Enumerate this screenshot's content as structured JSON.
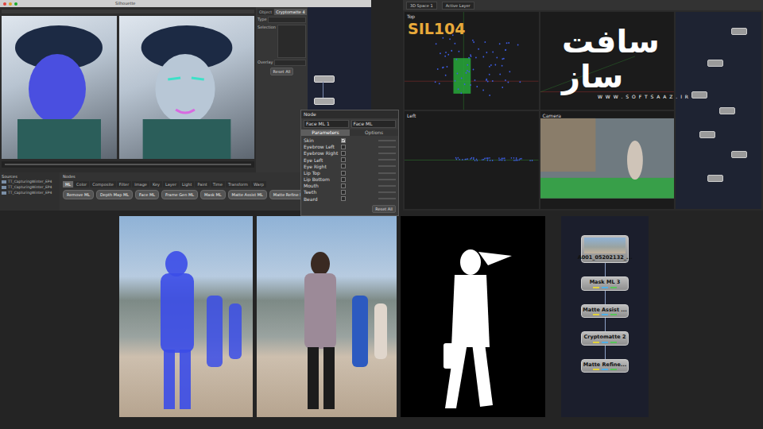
{
  "editor": {
    "title": "Silhouette",
    "side_panel": {
      "tabs": [
        {
          "label": "Object",
          "selected": false
        },
        {
          "label": "Cryptomatte 4",
          "selected": true
        }
      ],
      "fields": [
        "Type",
        "Selection",
        "Overlay"
      ],
      "button": "Reset All"
    },
    "sources": {
      "title": "Sources",
      "items": [
        "TT_CapturingWinter_EP4",
        "TT_CapturingWinter_EP4",
        "TT_CapturingWinter_EP4"
      ]
    },
    "nodes_panel": {
      "title": "Nodes",
      "tabs": [
        {
          "label": "ML",
          "selected": true
        },
        {
          "label": "Color",
          "selected": false
        },
        {
          "label": "Composite",
          "selected": false
        },
        {
          "label": "Filter",
          "selected": false
        },
        {
          "label": "Image",
          "selected": false
        },
        {
          "label": "Key",
          "selected": false
        },
        {
          "label": "Layer",
          "selected": false
        },
        {
          "label": "Light",
          "selected": false
        },
        {
          "label": "Paint",
          "selected": false
        },
        {
          "label": "Time",
          "selected": false
        },
        {
          "label": "Transform",
          "selected": false
        },
        {
          "label": "Warp",
          "selected": false
        }
      ],
      "buttons": [
        "Remove ML",
        "Depth Map ML",
        "Face ML",
        "Frame Gen ML",
        "Mask ML",
        "Matte Assist ML",
        "Matte Refine ML"
      ]
    }
  },
  "node_dialog": {
    "title": "Node",
    "name": "Face ML 1",
    "type": "Face ML",
    "tabs": [
      {
        "label": "Parameters",
        "selected": true
      },
      {
        "label": "Options",
        "selected": false
      }
    ],
    "items": [
      {
        "label": "Skin",
        "checked": true
      },
      {
        "label": "Eyebrow Left",
        "checked": false
      },
      {
        "label": "Eyebrow Right",
        "checked": false
      },
      {
        "label": "Eye Left",
        "checked": false
      },
      {
        "label": "Eye Right",
        "checked": false
      },
      {
        "label": "Lip Top",
        "checked": false
      },
      {
        "label": "Lip Bottom",
        "checked": false
      },
      {
        "label": "Mouth",
        "checked": false
      },
      {
        "label": "Teeth",
        "checked": false
      },
      {
        "label": "Beard",
        "checked": false
      }
    ],
    "button": "Reset All"
  },
  "space3d": {
    "toolbar": [
      "3D Space 1",
      "Active Layer"
    ],
    "badge": "SIL104",
    "viewports": [
      {
        "label": "Top",
        "kind": "top"
      },
      {
        "label": "",
        "kind": "persp"
      },
      {
        "label": "Left",
        "kind": "left"
      },
      {
        "label": "Camera",
        "kind": "camera"
      }
    ]
  },
  "watermark": {
    "logo": "سافت ساز",
    "url": "W W W . S O F T S A A Z . I R"
  },
  "node_graph": [
    {
      "label": "A001_05202132_...",
      "kind": "source"
    },
    {
      "label": "Mask ML 3",
      "kind": "node"
    },
    {
      "label": "Matte Assist ...",
      "kind": "node"
    },
    {
      "label": "Cryptomatte 2",
      "kind": "node"
    },
    {
      "label": "Matte Refine...",
      "kind": "node"
    }
  ]
}
